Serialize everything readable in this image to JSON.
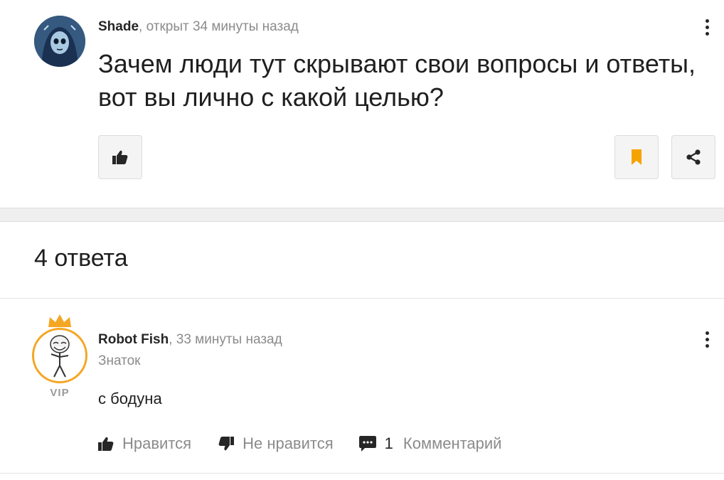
{
  "question": {
    "author": "Shade",
    "meta": ", открыт 34 минуты назад",
    "text": "Зачем люди тут скрывают свои вопросы и ответы, вот вы лично с какой целью?",
    "icons": {
      "like": "thumbs-up-icon",
      "bookmark": "bookmark-icon",
      "share": "share-icon",
      "menu": "more-vertical-icon"
    }
  },
  "answers": {
    "title": "4 ответа",
    "items": [
      {
        "author": "Robot Fish",
        "meta": ", 33 минуты назад",
        "rank": "Знаток",
        "badge": "VIP",
        "text": "с бодуна",
        "like_label": "Нравится",
        "dislike_label": "Не нравится",
        "comment_count": "1",
        "comment_label": "Комментарий"
      }
    ]
  },
  "colors": {
    "accent": "#f5a623",
    "bookmark": "#f5a300",
    "text": "#1f1f1f",
    "muted": "#8b8b8b"
  }
}
